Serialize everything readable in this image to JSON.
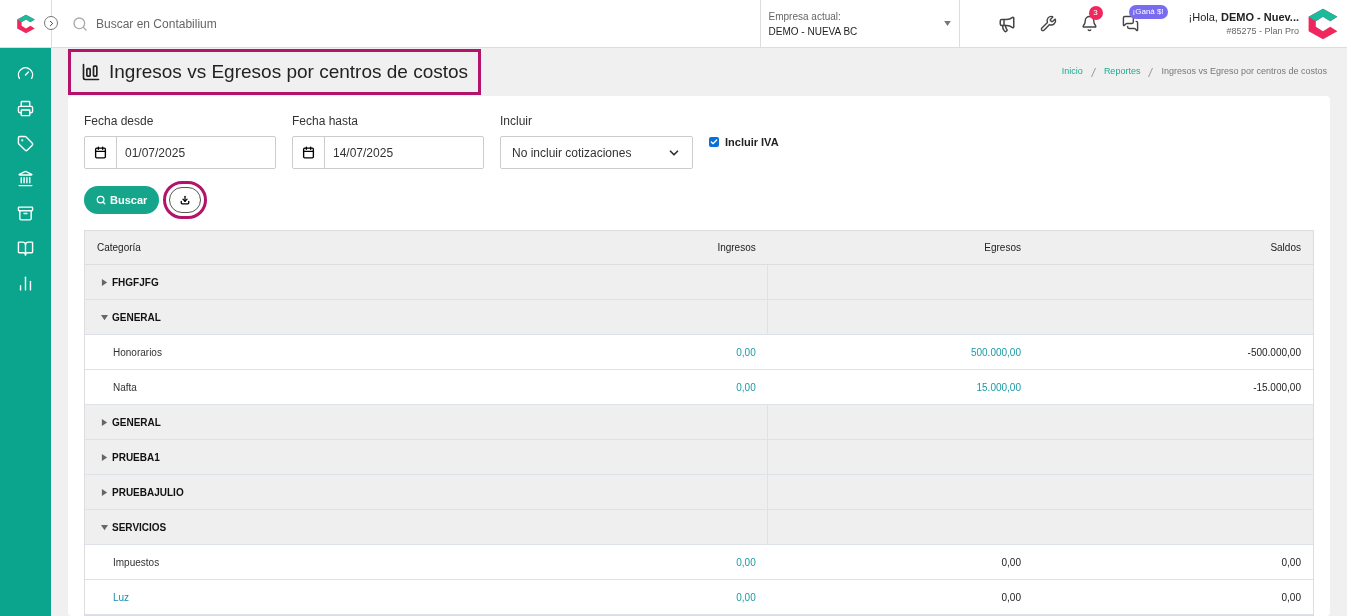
{
  "header": {
    "search": {
      "placeholder": "Buscar en Contabilium"
    },
    "company": {
      "label": "Empresa actual:",
      "value": "DEMO - NUEVA BC"
    },
    "notifications_count": "3",
    "promo_badge": "¡Ganá $!",
    "greeting": "¡Hola, **DEMO - Nuev...**",
    "account": "#85275 - Plan Pro"
  },
  "page": {
    "title": "Ingresos vs Egresos por centros de costos",
    "title_highlighted": true,
    "breadcrumb": [
      {
        "label": "Inicio",
        "link": true
      },
      {
        "label": "Reportes",
        "link": true
      },
      {
        "label": "Ingresos vs Egreso por centros de costos",
        "link": false
      }
    ]
  },
  "filters": {
    "date_from": {
      "label": "Fecha desde",
      "value": "01/07/2025"
    },
    "date_to": {
      "label": "Fecha hasta",
      "value": "14/07/2025"
    },
    "include": {
      "label": "Incluir",
      "value": "No incluir cotizaciones"
    },
    "include_iva": {
      "label": "Incluir IVA",
      "checked": true
    },
    "search_button": "Buscar",
    "download_highlighted": true
  },
  "table": {
    "columns": [
      "Categoría",
      "Ingresos",
      "Egresos",
      "Saldos"
    ],
    "rows": [
      {
        "kind": "group",
        "name": "FHGFJFG",
        "expanded": false
      },
      {
        "kind": "group",
        "name": "GENERAL",
        "expanded": true
      },
      {
        "kind": "item",
        "name": "Honorarios",
        "name_link": false,
        "cells": [
          {
            "text": "0,00",
            "link": true
          },
          {
            "text": "500.000,00",
            "link": true
          },
          {
            "text": "-500.000,00",
            "link": false
          }
        ]
      },
      {
        "kind": "item",
        "name": "Nafta",
        "name_link": false,
        "cells": [
          {
            "text": "0,00",
            "link": true
          },
          {
            "text": "15.000,00",
            "link": true
          },
          {
            "text": "-15.000,00",
            "link": false
          }
        ]
      },
      {
        "kind": "group",
        "name": "GENERAL",
        "expanded": false
      },
      {
        "kind": "group",
        "name": "PRUEBA1",
        "expanded": false
      },
      {
        "kind": "group",
        "name": "PRUEBAJULIO",
        "expanded": false
      },
      {
        "kind": "group",
        "name": "SERVICIOS",
        "expanded": true
      },
      {
        "kind": "item",
        "name": "Impuestos",
        "name_link": false,
        "cells": [
          {
            "text": "0,00",
            "link": true
          },
          {
            "text": "0,00",
            "link": false
          },
          {
            "text": "0,00",
            "link": false
          }
        ]
      },
      {
        "kind": "item",
        "name": "Luz",
        "name_link": true,
        "cells": [
          {
            "text": "0,00",
            "link": true
          },
          {
            "text": "0,00",
            "link": false
          },
          {
            "text": "0,00",
            "link": false
          }
        ]
      }
    ]
  }
}
